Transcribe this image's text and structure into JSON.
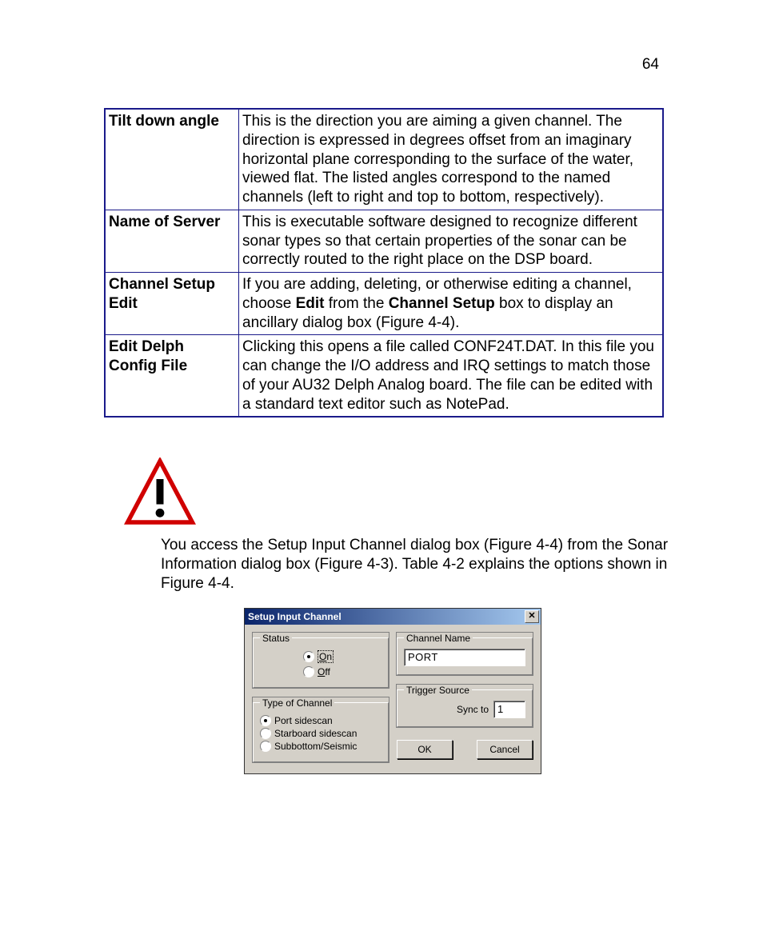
{
  "page_number": "64",
  "table_rows": [
    {
      "label": "Tilt down angle",
      "desc": "This is the direction you are aiming a given channel. The direction is expressed in degrees offset from an imaginary horizontal plane corresponding to the surface of the water, viewed flat. The listed angles correspond to the named channels (left to right and top to bottom, respectively)."
    },
    {
      "label": "Name of Server",
      "desc": "This is executable software designed to recognize different sonar types so that certain properties of the sonar can be correctly routed to the right place on the DSP board."
    },
    {
      "label": "Channel Setup Edit",
      "desc_parts": [
        "If you are adding, deleting, or otherwise editing a channel, choose ",
        "Edit",
        " from the ",
        "Channel Setup",
        " box to display an ancillary dialog box (Figure 4-4)."
      ]
    },
    {
      "label": "Edit Delph Config File",
      "desc": "Clicking this opens a file called CONF24T.DAT. In this file you can change the I/O address and IRQ settings to match those of your AU32 Delph Analog board. The file can be edited with a standard text editor such as NotePad."
    }
  ],
  "intro_paragraph": "You access the Setup Input Channel dialog box (Figure 4-4) from the Sonar Information dialog box (Figure 4-3). Table 4-2 explains the options shown in Figure 4-4.",
  "dialog": {
    "title": "Setup Input Channel",
    "groups": {
      "status": {
        "legend": "Status",
        "on": "On",
        "off": "Off"
      },
      "type": {
        "legend": "Type of Channel",
        "opt1": "Port sidescan",
        "opt2": "Starboard sidescan",
        "opt3": "Subbottom/Seismic"
      },
      "name": {
        "legend": "Channel Name",
        "value": "PORT"
      },
      "trigger": {
        "legend": "Trigger Source",
        "sync_label": "Sync to",
        "value": "1"
      }
    },
    "buttons": {
      "ok": "OK",
      "cancel": "Cancel"
    }
  }
}
